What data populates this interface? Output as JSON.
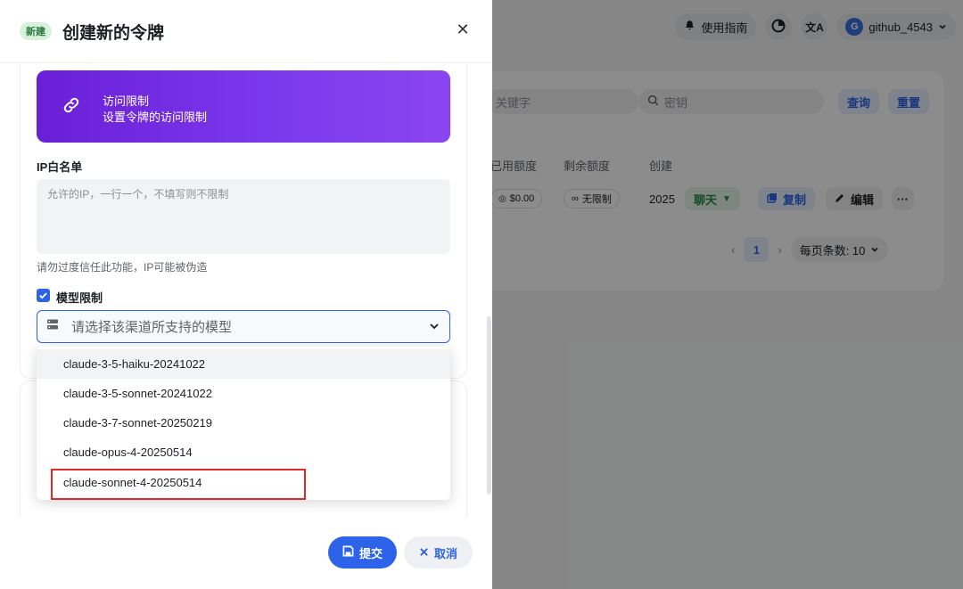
{
  "background": {
    "nav": {
      "guide_label": "使用指南",
      "username": "github_4543",
      "avatar_letter": "G"
    },
    "search": {
      "keyword_placeholder": "关键字",
      "key_placeholder": "密钥",
      "query_label": "查询",
      "reset_label": "重置"
    },
    "table": {
      "headers": [
        "已用额度",
        "剩余额度",
        "创建"
      ],
      "row": {
        "used": "$0.00",
        "remaining": "无限制",
        "created": "2025",
        "chat_label": "聊天",
        "copy_label": "复制",
        "edit_label": "编辑",
        "more": "···"
      }
    },
    "pager": {
      "current_page": "1",
      "page_size_label": "每页条数: 10"
    }
  },
  "sheet": {
    "badge": "新建",
    "title": "创建新的令牌",
    "close": "✕",
    "access_card": {
      "title": "访问限制",
      "subtitle": "设置令牌的访问限制"
    },
    "ip_whitelist": {
      "label": "IP白名单",
      "placeholder": "允许的IP，一行一个，不填写则不限制",
      "hint": "请勿过度信任此功能，IP可能被伪造"
    },
    "model_limit": {
      "label": "模型限制",
      "checked": true,
      "select_placeholder": "请选择该渠道所支持的模型",
      "options": [
        "claude-3-5-haiku-20241022",
        "claude-3-5-sonnet-20241022",
        "claude-3-7-sonnet-20250219",
        "claude-opus-4-20250514",
        "claude-sonnet-4-20250514"
      ]
    },
    "footer": {
      "submit_label": "提交",
      "cancel_label": "取消"
    }
  },
  "colors": {
    "primary": "#2c63e8",
    "purple_card": "#7c3aed",
    "highlight_box": "#e0282e",
    "new_badge_bg": "#d7f2dc"
  }
}
